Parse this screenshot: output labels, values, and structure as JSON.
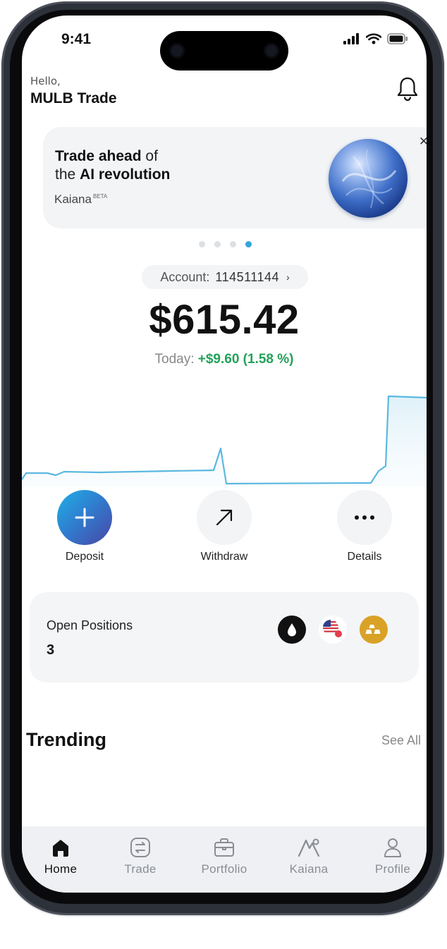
{
  "status_bar": {
    "time": "9:41"
  },
  "header": {
    "greeting": "Hello,",
    "username": "MULB Trade"
  },
  "promo": {
    "line1_bold": "Trade ahead",
    "line1_rest": " of",
    "line2_pre": "the ",
    "line2_bold": "AI revolution",
    "brand": "Kaiana",
    "brand_badge": "BETA"
  },
  "carousel": {
    "page_count": 4,
    "active_index": 3
  },
  "account": {
    "label": "Account:",
    "number": "114511144",
    "balance": "$615.42",
    "today_label": "Today:",
    "today_change": "+$9.60 (1.58 %)"
  },
  "actions": [
    {
      "label": "Deposit",
      "icon": "plus-icon"
    },
    {
      "label": "Withdraw",
      "icon": "arrow-up-right-icon"
    },
    {
      "label": "Details",
      "icon": "more-icon"
    }
  ],
  "open_positions": {
    "title": "Open Positions",
    "count": "3",
    "assets": [
      "oil-icon",
      "us-flag-icon",
      "gold-bars-icon"
    ]
  },
  "trending": {
    "title": "Trending",
    "see_all": "See All"
  },
  "tabbar": {
    "active": "Home",
    "items": [
      {
        "label": "Home",
        "icon": "home-icon"
      },
      {
        "label": "Trade",
        "icon": "trade-icon"
      },
      {
        "label": "Portfolio",
        "icon": "briefcase-icon"
      },
      {
        "label": "Kaiana",
        "icon": "kaiana-icon"
      },
      {
        "label": "Profile",
        "icon": "profile-icon"
      }
    ]
  },
  "colors": {
    "accent": "#35a5d9",
    "gain": "#22a25a",
    "chart_line": "#5bb8e0",
    "gold": "#d9a227"
  }
}
